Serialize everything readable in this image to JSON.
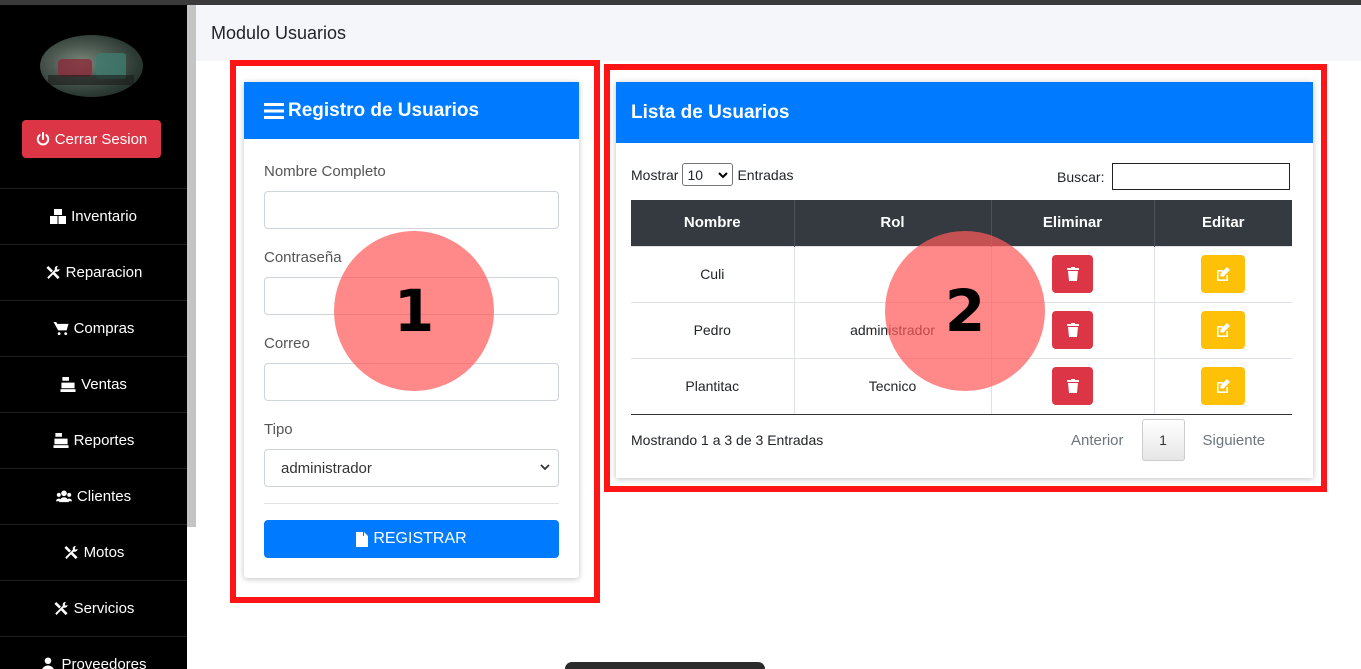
{
  "header": {
    "title": "Modulo Usuarios"
  },
  "sidebar": {
    "logout_label": "Cerrar Sesion",
    "items": [
      {
        "label": "Inventario",
        "icon": "boxes-icon"
      },
      {
        "label": "Reparacion",
        "icon": "tools-icon"
      },
      {
        "label": "Compras",
        "icon": "cart-icon"
      },
      {
        "label": "Ventas",
        "icon": "cash-register-icon"
      },
      {
        "label": "Reportes",
        "icon": "cash-register-icon"
      },
      {
        "label": "Clientes",
        "icon": "users-icon"
      },
      {
        "label": "Motos",
        "icon": "tools-icon"
      },
      {
        "label": "Servicios",
        "icon": "tools-icon"
      },
      {
        "label": "Proveedores",
        "icon": "user-tie-icon"
      }
    ]
  },
  "registro": {
    "title": "Registro de Usuarios",
    "fields": {
      "nombre": {
        "label": "Nombre Completo",
        "value": ""
      },
      "contrasena": {
        "label": "Contraseña",
        "value": ""
      },
      "correo": {
        "label": "Correo",
        "value": ""
      },
      "tipo": {
        "label": "Tipo",
        "value": "administrador"
      }
    },
    "submit_label": "REGISTRAR"
  },
  "lista": {
    "title": "Lista de Usuarios",
    "length": {
      "prefix": "Mostrar",
      "value": "10",
      "suffix": "Entradas"
    },
    "search_label": "Buscar:",
    "columns": [
      "Nombre",
      "Rol",
      "Eliminar",
      "Editar"
    ],
    "rows": [
      {
        "nombre": "Culi",
        "rol": ""
      },
      {
        "nombre": "Pedro",
        "rol": "administrador"
      },
      {
        "nombre": "Plantitac",
        "rol": "Tecnico"
      }
    ],
    "info": "Mostrando 1 a 3 de 3 Entradas",
    "pager": {
      "prev": "Anterior",
      "page": "1",
      "next": "Siguiente"
    }
  },
  "annotations": {
    "marker_1": "1",
    "marker_2": "2"
  },
  "colors": {
    "primary": "#007bff",
    "danger": "#dc3545",
    "warning": "#ffc107",
    "annotation_red": "#ff1515",
    "table_head": "#343a40"
  }
}
